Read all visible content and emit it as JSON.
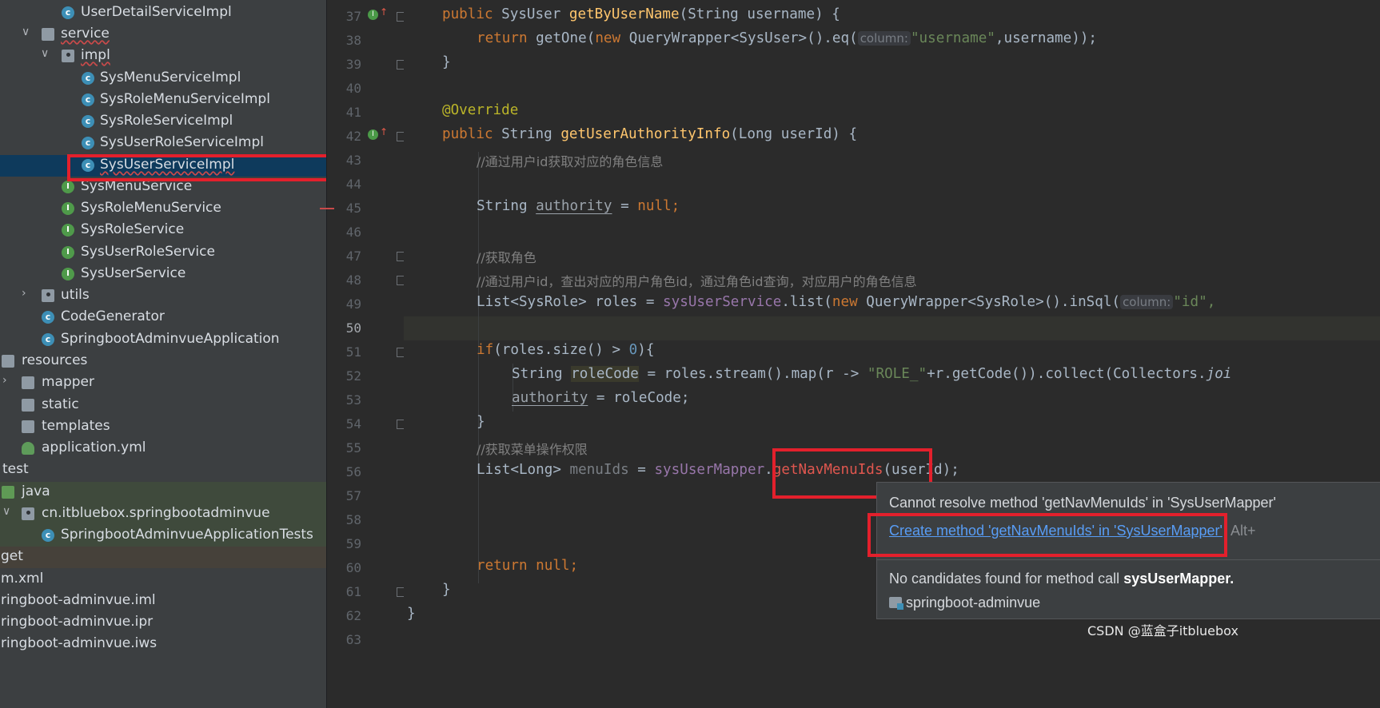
{
  "tree": {
    "items": [
      {
        "label": "UserDetailServiceImpl",
        "icon": "class-icon",
        "squiggle": false
      },
      {
        "label": "service",
        "icon": "folder-icon",
        "squiggle": true
      },
      {
        "label": "impl",
        "icon": "package-icon",
        "squiggle": true
      },
      {
        "label": "SysMenuServiceImpl",
        "icon": "class-icon",
        "squiggle": false
      },
      {
        "label": "SysRoleMenuServiceImpl",
        "icon": "class-icon",
        "squiggle": false
      },
      {
        "label": "SysRoleServiceImpl",
        "icon": "class-icon",
        "squiggle": false
      },
      {
        "label": "SysUserRoleServiceImpl",
        "icon": "class-icon",
        "squiggle": false
      },
      {
        "label": "SysUserServiceImpl",
        "icon": "class-icon",
        "squiggle": true,
        "selected": true
      },
      {
        "label": "SysMenuService",
        "icon": "interface-icon"
      },
      {
        "label": "SysRoleMenuService",
        "icon": "interface-icon"
      },
      {
        "label": "SysRoleService",
        "icon": "interface-icon"
      },
      {
        "label": "SysUserRoleService",
        "icon": "interface-icon"
      },
      {
        "label": "SysUserService",
        "icon": "interface-icon"
      },
      {
        "label": "utils",
        "icon": "package-icon"
      },
      {
        "label": "CodeGenerator",
        "icon": "class-icon"
      },
      {
        "label": "SpringbootAdminvueApplication",
        "icon": "spring-class-icon"
      },
      {
        "label": "resources",
        "icon": "resources-folder-icon"
      },
      {
        "label": "mapper",
        "icon": "folder-icon"
      },
      {
        "label": "static",
        "icon": "folder-icon"
      },
      {
        "label": "templates",
        "icon": "folder-icon"
      },
      {
        "label": "application.yml",
        "icon": "yaml-icon"
      },
      {
        "label": "test",
        "icon": "none"
      },
      {
        "label": "java",
        "icon": "test-folder-icon"
      },
      {
        "label": "cn.itbluebox.springbootadminvue",
        "icon": "package-icon"
      },
      {
        "label": "SpringbootAdminvueApplicationTests",
        "icon": "test-class-icon"
      },
      {
        "label": "get",
        "icon": "none"
      },
      {
        "label": "m.xml",
        "icon": "none"
      },
      {
        "label": "ringboot-adminvue.iml",
        "icon": "none"
      },
      {
        "label": "ringboot-adminvue.ipr",
        "icon": "none"
      },
      {
        "label": "ringboot-adminvue.iws",
        "icon": "none"
      }
    ]
  },
  "gutter": {
    "lines": [
      "37",
      "38",
      "39",
      "40",
      "41",
      "42",
      "43",
      "44",
      "45",
      "46",
      "47",
      "48",
      "49",
      "50",
      "51",
      "52",
      "53",
      "54",
      "55",
      "56",
      "57",
      "58",
      "59",
      "60",
      "61",
      "62",
      "63"
    ]
  },
  "code": {
    "l37": {
      "k1": "public ",
      "t1": "SysUser ",
      "f": "getByUserName",
      "t2": "(String username) {"
    },
    "l38": {
      "k1": "return ",
      "t1": "getOne(",
      "k2": "new ",
      "t2": "QueryWrapper<SysUser>().eq(",
      "hint": "column:",
      "s": "\"username\"",
      "t3": ",username));"
    },
    "l39": {
      "t": "}"
    },
    "l41": {
      "a": "@Override"
    },
    "l42": {
      "k1": "public ",
      "t1": "String ",
      "f": "getUserAuthorityInfo",
      "t2": "(Long userId) {"
    },
    "l43": {
      "c": "//通过用户id获取对应的角色信息"
    },
    "l45": {
      "t1": "String ",
      "v": "authority",
      "t2": " = ",
      "k": "null",
      "t3": ";"
    },
    "l47": {
      "c": "//获取角色"
    },
    "l48": {
      "c": "//通过用户id，查出对应的用户角色id，通过角色id查询，对应用户的角色信息"
    },
    "l49": {
      "t1": "List<SysRole> roles = ",
      "fld": "sysUserService",
      "t2": ".list(",
      "k": "new ",
      "t3": "QueryWrapper<SysRole>().inSql(",
      "hint": "column:",
      "s": "\"id\","
    },
    "l51": {
      "k": "if",
      "t1": "(roles.size() > ",
      "n": "0",
      "t2": "){"
    },
    "l52": {
      "t1": "String ",
      "v": "roleCode",
      "t2": " = roles.stream().map(r -> ",
      "s": "\"ROLE_\"",
      "t3": "+r.getCode()).collect(Collectors.",
      "i": "joi"
    },
    "l53": {
      "v": "authority",
      "t1": " = roleCode;"
    },
    "l54": {
      "t": "}"
    },
    "l55": {
      "c": "//获取菜单操作权限"
    },
    "l56": {
      "t1": "List<Long> ",
      "u": "menuIds",
      "t2": " = ",
      "fld": "sysUserMapper",
      "t3": ".",
      "e": "getNavMenuIds",
      "t4": "(userId);"
    },
    "l60": {
      "k": "return null",
      "t": ";"
    },
    "l61": {
      "t": "}"
    },
    "l62": {
      "t": "}"
    }
  },
  "popup": {
    "error": "Cannot resolve method 'getNavMenuIds' in 'SysUserMapper'",
    "fix": "Create method 'getNavMenuIds' in 'SysUserMapper'",
    "shortcut": "Alt+",
    "nocand_prefix": "No candidates found for method call ",
    "nocand_bold": "sysUserMapper.",
    "module": "springboot-adminvue"
  },
  "watermark": "CSDN @蓝盒子itbluebox",
  "colors": {
    "highlight_box": "#e3202c",
    "selection": "#0e3a5c",
    "link": "#589df6"
  }
}
